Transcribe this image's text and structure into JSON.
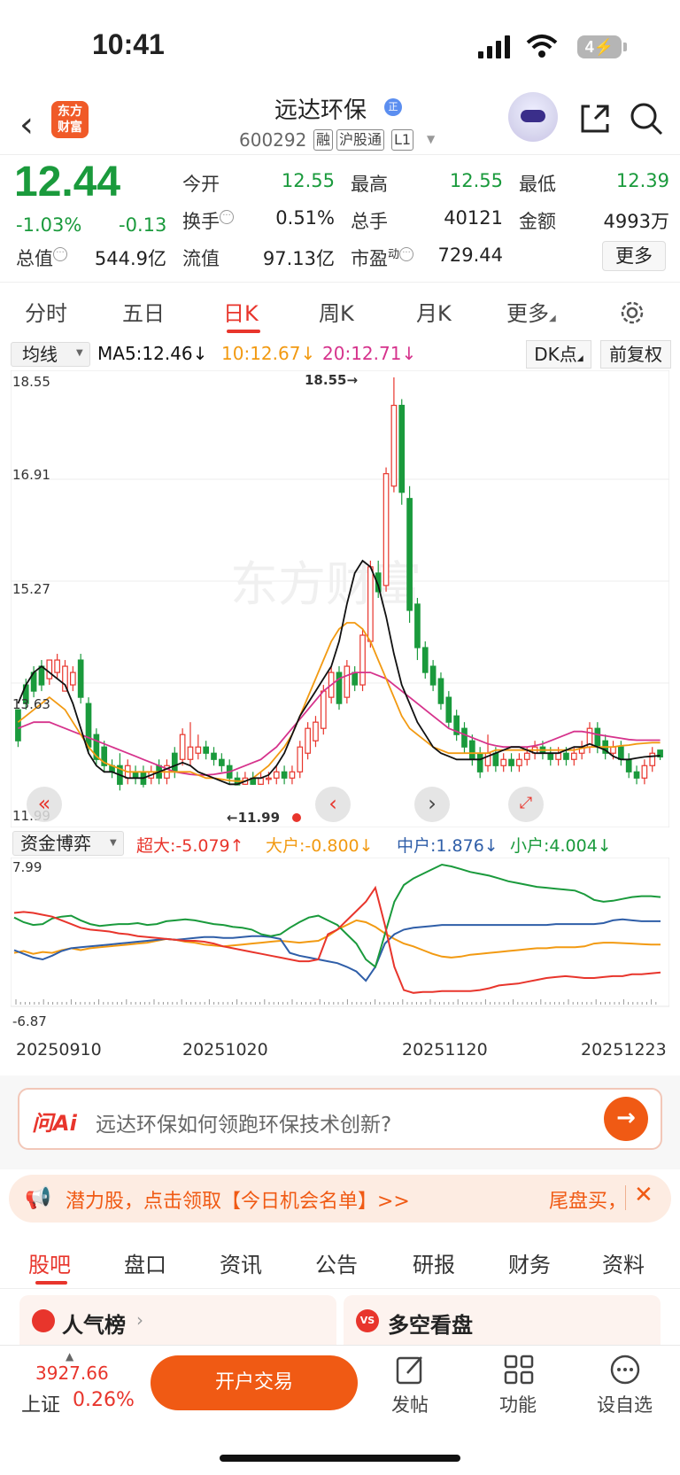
{
  "status_bar": {
    "time": "10:41",
    "battery": "4"
  },
  "header": {
    "logo_text_line1": "东方",
    "logo_text_line2": "财富",
    "stock_name": "远达环保",
    "badge": "正",
    "stock_code": "600292",
    "tags": [
      "融",
      "沪股通",
      "L1"
    ]
  },
  "quote": {
    "price": "12.44",
    "change_pct": "-1.03%",
    "change_amt": "-0.13",
    "rows": [
      [
        {
          "label": "今开",
          "value": "12.55",
          "color": "green"
        },
        {
          "label": "最高",
          "value": "12.55",
          "color": "green"
        },
        {
          "label": "最低",
          "value": "12.39",
          "color": "green"
        }
      ],
      [
        {
          "label": "换手",
          "value": "0.51%",
          "color": "black"
        },
        {
          "label": "总手",
          "value": "40121",
          "color": "black"
        },
        {
          "label": "金额",
          "value": "4993万",
          "color": "black"
        }
      ],
      [
        {
          "label": "总值",
          "value": "544.9亿",
          "color": "black"
        },
        {
          "label": "流值",
          "value": "97.13亿",
          "color": "black"
        },
        {
          "label": "市盈",
          "label_sup": "动",
          "value": "729.44",
          "color": "black"
        }
      ]
    ],
    "more_label": "更多"
  },
  "period_tabs": [
    "分时",
    "五日",
    "日K",
    "周K",
    "月K",
    "更多"
  ],
  "active_period": "日K",
  "ma_legend": {
    "select": "均线",
    "ma5": "MA5:12.46↓",
    "ma10": "10:12.67↓",
    "ma20": "20:12.71↓",
    "dk_label": "DK点",
    "fq_label": "前复权"
  },
  "kline": {
    "price_labels": [
      "18.55",
      "16.91",
      "15.27",
      "13.63",
      "11.99"
    ],
    "max_label": "18.55→",
    "min_label": "←11.99",
    "watermark": "东方财富",
    "candles": [
      [
        13.2,
        12.7,
        13.2,
        12.6
      ],
      [
        13.6,
        13.3,
        13.7,
        13.2
      ],
      [
        13.8,
        13.5,
        13.9,
        13.4
      ],
      [
        13.9,
        13.6,
        14.0,
        13.5
      ],
      [
        13.7,
        14.0,
        14.0,
        13.6
      ],
      [
        13.8,
        14.0,
        14.1,
        13.7
      ],
      [
        13.5,
        13.9,
        14.0,
        13.5
      ],
      [
        13.6,
        13.8,
        13.9,
        13.5
      ],
      [
        14.0,
        13.4,
        14.1,
        13.3
      ],
      [
        13.3,
        12.6,
        13.4,
        12.5
      ],
      [
        12.8,
        12.4,
        12.9,
        12.3
      ],
      [
        12.6,
        12.3,
        12.7,
        12.2
      ],
      [
        12.3,
        12.2,
        12.4,
        12.1
      ],
      [
        12.3,
        12.0,
        12.5,
        11.9
      ],
      [
        12.1,
        12.3,
        12.4,
        12.0
      ],
      [
        12.2,
        12.1,
        12.3,
        12.0
      ],
      [
        12.2,
        12.0,
        12.3,
        11.95
      ],
      [
        12.1,
        12.2,
        12.3,
        12.0
      ],
      [
        12.3,
        12.1,
        12.4,
        12.0
      ],
      [
        12.1,
        12.3,
        12.4,
        12.0
      ],
      [
        12.5,
        12.2,
        12.6,
        12.1
      ],
      [
        12.4,
        12.8,
        12.9,
        12.3
      ],
      [
        12.4,
        12.6,
        13.0,
        12.3
      ],
      [
        12.5,
        12.6,
        12.8,
        12.4
      ],
      [
        12.6,
        12.5,
        12.7,
        12.4
      ],
      [
        12.5,
        12.4,
        12.6,
        12.3
      ],
      [
        12.4,
        12.3,
        12.5,
        12.2
      ],
      [
        12.3,
        12.1,
        12.4,
        12.0
      ],
      [
        12.1,
        11.99,
        12.2,
        11.99
      ],
      [
        12.0,
        12.1,
        12.2,
        11.99
      ],
      [
        12.1,
        12.0,
        12.2,
        11.99
      ],
      [
        12.0,
        12.1,
        12.2,
        11.99
      ],
      [
        12.1,
        12.1,
        12.2,
        12.0
      ],
      [
        12.1,
        12.2,
        12.3,
        12.0
      ],
      [
        12.2,
        12.1,
        12.3,
        12.0
      ],
      [
        12.1,
        12.2,
        12.3,
        12.0
      ],
      [
        12.2,
        12.6,
        12.7,
        12.1
      ],
      [
        12.5,
        12.9,
        13.0,
        12.4
      ],
      [
        12.7,
        13.0,
        13.1,
        12.6
      ],
      [
        12.9,
        13.5,
        13.6,
        12.8
      ],
      [
        13.4,
        13.8,
        13.9,
        13.3
      ],
      [
        13.8,
        13.3,
        13.9,
        13.2
      ],
      [
        13.4,
        13.9,
        14.0,
        13.3
      ],
      [
        13.8,
        13.6,
        13.9,
        13.5
      ],
      [
        13.6,
        14.4,
        14.5,
        13.5
      ],
      [
        14.3,
        15.5,
        15.6,
        14.2
      ],
      [
        15.4,
        15.1,
        15.6,
        15.0
      ],
      [
        15.2,
        17.0,
        17.1,
        15.1
      ],
      [
        16.8,
        18.1,
        18.55,
        16.7
      ],
      [
        18.1,
        16.7,
        18.2,
        16.5
      ],
      [
        16.6,
        14.8,
        16.8,
        14.6
      ],
      [
        14.9,
        14.2,
        15.0,
        14.0
      ],
      [
        14.2,
        13.8,
        14.3,
        13.7
      ],
      [
        13.9,
        13.6,
        14.0,
        13.5
      ],
      [
        13.7,
        13.3,
        13.8,
        13.2
      ],
      [
        13.4,
        13.0,
        13.5,
        12.9
      ],
      [
        13.1,
        12.8,
        13.2,
        12.7
      ],
      [
        12.9,
        12.6,
        13.0,
        12.5
      ],
      [
        12.7,
        12.4,
        12.8,
        12.3
      ],
      [
        12.5,
        12.2,
        12.6,
        12.1
      ],
      [
        12.3,
        12.5,
        12.8,
        12.2
      ],
      [
        12.5,
        12.3,
        12.6,
        12.2
      ],
      [
        12.3,
        12.4,
        12.5,
        12.2
      ],
      [
        12.4,
        12.3,
        12.5,
        12.2
      ],
      [
        12.3,
        12.4,
        12.5,
        12.2
      ],
      [
        12.4,
        12.5,
        12.6,
        12.3
      ],
      [
        12.5,
        12.6,
        12.7,
        12.4
      ],
      [
        12.6,
        12.5,
        12.7,
        12.4
      ],
      [
        12.5,
        12.4,
        12.6,
        12.3
      ],
      [
        12.4,
        12.5,
        12.6,
        12.3
      ],
      [
        12.5,
        12.4,
        12.6,
        12.3
      ],
      [
        12.4,
        12.5,
        12.6,
        12.3
      ],
      [
        12.5,
        12.6,
        12.7,
        12.4
      ],
      [
        12.6,
        12.9,
        13.0,
        12.5
      ],
      [
        12.9,
        12.6,
        13.0,
        12.5
      ],
      [
        12.7,
        12.5,
        12.8,
        12.4
      ],
      [
        12.5,
        12.6,
        12.7,
        12.4
      ],
      [
        12.6,
        12.4,
        12.7,
        12.3
      ],
      [
        12.4,
        12.2,
        12.5,
        12.1
      ],
      [
        12.2,
        12.1,
        12.3,
        12.0
      ],
      [
        12.1,
        12.3,
        12.4,
        12.0
      ],
      [
        12.3,
        12.5,
        12.6,
        12.2
      ],
      [
        12.55,
        12.44,
        12.55,
        12.39
      ]
    ],
    "ma5": [
      13.3,
      13.6,
      13.8,
      13.9,
      13.8,
      13.7,
      13.6,
      13.3,
      12.9,
      12.5,
      12.3,
      12.2,
      12.2,
      12.15,
      12.1,
      12.1,
      12.1,
      12.15,
      12.2,
      12.25,
      12.3,
      12.35,
      12.3,
      12.2,
      12.15,
      12.1,
      12.05,
      12.0,
      12.0,
      12.05,
      12.1,
      12.1,
      12.15,
      12.3,
      12.5,
      12.8,
      13.1,
      13.3,
      13.5,
      13.7,
      13.9,
      14.3,
      14.9,
      15.4,
      15.6,
      15.5,
      15.2,
      14.7,
      14.1,
      13.6,
      13.3,
      13.0,
      12.8,
      12.6,
      12.5,
      12.45,
      12.4,
      12.4,
      12.4,
      12.4,
      12.45,
      12.5,
      12.55,
      12.6,
      12.6,
      12.55,
      12.5,
      12.5,
      12.5,
      12.5,
      12.55,
      12.6,
      12.6,
      12.65,
      12.6,
      12.55,
      12.45,
      12.4,
      12.4,
      12.42,
      12.44,
      12.45,
      12.46
    ],
    "ma10": [
      13.0,
      13.1,
      13.2,
      13.3,
      13.4,
      13.3,
      13.2,
      13.0,
      12.8,
      12.6,
      12.45,
      12.35,
      12.3,
      12.25,
      12.2,
      12.2,
      12.2,
      12.2,
      12.2,
      12.2,
      12.2,
      12.2,
      12.2,
      12.15,
      12.1,
      12.1,
      12.08,
      12.06,
      12.05,
      12.05,
      12.1,
      12.2,
      12.3,
      12.45,
      12.6,
      12.8,
      13.1,
      13.4,
      13.7,
      14.0,
      14.3,
      14.5,
      14.6,
      14.6,
      14.5,
      14.3,
      14.0,
      13.7,
      13.4,
      13.1,
      12.9,
      12.8,
      12.7,
      12.6,
      12.55,
      12.5,
      12.5,
      12.5,
      12.5,
      12.5,
      12.5,
      12.55,
      12.55,
      12.55,
      12.55,
      12.55,
      12.55,
      12.55,
      12.55,
      12.55,
      12.55,
      12.55,
      12.58,
      12.6,
      12.6,
      12.6,
      12.6,
      12.62,
      12.63,
      12.65,
      12.66,
      12.67,
      12.67
    ],
    "ma20": [
      12.9,
      12.95,
      13.0,
      13.0,
      13.0,
      12.95,
      12.9,
      12.85,
      12.8,
      12.75,
      12.7,
      12.65,
      12.6,
      12.55,
      12.5,
      12.45,
      12.4,
      12.35,
      12.3,
      12.25,
      12.2,
      12.18,
      12.16,
      12.15,
      12.15,
      12.16,
      12.18,
      12.2,
      12.25,
      12.3,
      12.35,
      12.4,
      12.5,
      12.6,
      12.75,
      12.9,
      13.05,
      13.2,
      13.35,
      13.5,
      13.6,
      13.7,
      13.75,
      13.8,
      13.8,
      13.8,
      13.75,
      13.7,
      13.6,
      13.5,
      13.4,
      13.3,
      13.2,
      13.1,
      13.0,
      12.9,
      12.85,
      12.8,
      12.75,
      12.7,
      12.65,
      12.62,
      12.6,
      12.6,
      12.6,
      12.6,
      12.62,
      12.65,
      12.7,
      12.75,
      12.8,
      12.85,
      12.85,
      12.83,
      12.8,
      12.78,
      12.76,
      12.74,
      12.72,
      12.71,
      12.71,
      12.71,
      12.71
    ]
  },
  "fund_flow": {
    "select": "资金博弈",
    "super_large": "超大:-5.079↑",
    "large": "大户:-0.800↓",
    "medium": "中户:1.876↓",
    "small": "小户:4.004↓",
    "y_max": "7.99",
    "y_min": "-6.87",
    "dates": [
      "20250910",
      "20251020",
      "20251120",
      "20251223"
    ],
    "series_red": [
      2.8,
      2.9,
      2.8,
      2.6,
      2.4,
      2.0,
      1.6,
      1.2,
      1.0,
      0.9,
      0.8,
      0.6,
      0.5,
      0.3,
      0.2,
      0.1,
      0.0,
      -0.1,
      -0.2,
      -0.2,
      -0.3,
      -0.5,
      -0.8,
      -1.0,
      -1.2,
      -1.4,
      -1.6,
      -1.8,
      -2.0,
      -2.2,
      -2.4,
      -2.4,
      -2.2,
      0.5,
      1.0,
      2.0,
      3.0,
      4.0,
      5.5,
      1.5,
      -3.0,
      -5.5,
      -5.8,
      -5.7,
      -5.7,
      -5.6,
      -5.6,
      -5.6,
      -5.6,
      -5.5,
      -5.3,
      -5.0,
      -4.9,
      -4.8,
      -4.6,
      -4.4,
      -4.2,
      -4.1,
      -4.0,
      -4.1,
      -4.2,
      -4.2,
      -4.1,
      -4.0,
      -4.0,
      -3.8,
      -3.8,
      -3.7,
      -3.6
    ],
    "series_orange": [
      -1.5,
      -1.3,
      -1.6,
      -1.4,
      -1.5,
      -1.2,
      -1.0,
      -1.2,
      -1.0,
      -0.9,
      -0.8,
      -0.7,
      -0.6,
      -0.5,
      -0.4,
      -0.2,
      0.0,
      -0.1,
      -0.3,
      -0.4,
      -0.6,
      -0.7,
      -0.8,
      -0.7,
      -0.6,
      -0.5,
      -0.4,
      -0.3,
      -0.2,
      -0.3,
      -0.4,
      -0.3,
      -0.2,
      0.3,
      1.0,
      1.5,
      2.0,
      1.8,
      1.3,
      0.6,
      0.0,
      -0.5,
      -0.8,
      -1.2,
      -1.6,
      -1.9,
      -2.0,
      -1.9,
      -1.7,
      -1.6,
      -1.5,
      -1.4,
      -1.3,
      -1.2,
      -1.1,
      -1.0,
      -1.0,
      -0.9,
      -0.9,
      -0.9,
      -0.8,
      -0.5,
      -0.4,
      -0.4,
      -0.45,
      -0.5,
      -0.55,
      -0.6,
      -0.6
    ],
    "series_blue": [
      -1.2,
      -1.6,
      -2.0,
      -2.2,
      -1.8,
      -1.3,
      -1.0,
      -0.9,
      -0.8,
      -0.7,
      -0.6,
      -0.5,
      -0.4,
      -0.3,
      -0.2,
      -0.1,
      0.0,
      -0.1,
      0.0,
      0.1,
      0.2,
      0.2,
      0.1,
      0.1,
      0.2,
      0.3,
      0.3,
      0.2,
      0.0,
      -1.5,
      -1.8,
      -2.0,
      -2.2,
      -2.4,
      -2.6,
      -3.0,
      -3.5,
      -4.5,
      -3.0,
      -0.5,
      0.5,
      1.0,
      1.2,
      1.3,
      1.4,
      1.5,
      1.5,
      1.5,
      1.5,
      1.5,
      1.5,
      1.5,
      1.5,
      1.5,
      1.5,
      1.5,
      1.5,
      1.6,
      1.6,
      1.6,
      1.6,
      1.6,
      1.7,
      2.0,
      2.1,
      2.0,
      1.9,
      1.9,
      1.9
    ],
    "series_green": [
      2.3,
      1.8,
      1.5,
      1.6,
      2.2,
      2.4,
      2.5,
      2.0,
      1.6,
      1.4,
      1.5,
      1.6,
      1.6,
      1.7,
      1.5,
      1.6,
      1.9,
      2.0,
      2.1,
      2.0,
      1.8,
      1.6,
      1.5,
      1.3,
      1.2,
      1.0,
      0.5,
      0.3,
      0.5,
      1.2,
      1.8,
      2.3,
      2.5,
      2.0,
      1.5,
      0.5,
      -0.5,
      -2.2,
      -3.0,
      0.5,
      4.0,
      5.8,
      6.5,
      7.0,
      7.5,
      7.99,
      7.8,
      7.5,
      7.2,
      7.0,
      6.8,
      6.5,
      6.2,
      6.0,
      5.8,
      5.6,
      5.5,
      5.4,
      5.3,
      5.2,
      4.8,
      4.2,
      4.0,
      4.1,
      4.3,
      4.5,
      4.6,
      4.6,
      4.5
    ]
  },
  "ask_ai": {
    "logo": "问Ai",
    "question": "远达环保如何领跑环保技术创新?"
  },
  "promo": {
    "text": "潜力股，点击领取【今日机会名单】>>",
    "right": "尾盘买，",
    "close": "✕"
  },
  "content_tabs": [
    "股吧",
    "盘口",
    "资讯",
    "公告",
    "研报",
    "财务",
    "资料"
  ],
  "cards": {
    "hot": "人气榜",
    "long_short": "多空看盘"
  },
  "bottom_bar": {
    "index_value": "3927.66",
    "index_name": "上证",
    "index_pct": "0.26%",
    "trade_button": "开户交易",
    "post_label": "发帖",
    "function_label": "功能",
    "watchlist_label": "设自选"
  },
  "colors": {
    "up": "#e8352c",
    "down": "#1a9a3c",
    "ma5": "#111111",
    "ma10": "#f29a12",
    "ma20": "#d6338c",
    "medium": "#2f5ea8",
    "accent": "#f05a14"
  }
}
